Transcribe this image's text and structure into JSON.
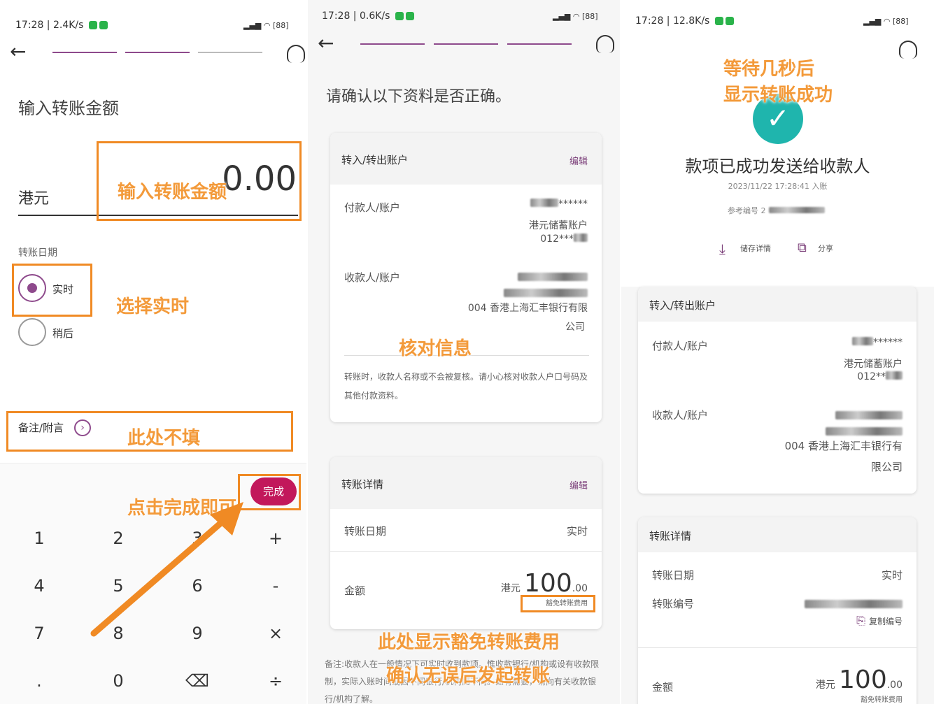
{
  "panel1": {
    "status_time": "17:28 | 2.4K/s",
    "battery": "88",
    "page_title": "输入转账金额",
    "currency": "港元",
    "amount": "0.00",
    "date_label": "转账日期",
    "radio_now": "实时",
    "radio_later": "稍后",
    "memo_label": "备注/附言",
    "done_button": "完成",
    "keypad": [
      "1",
      "2",
      "3",
      "+",
      "4",
      "5",
      "6",
      "-",
      "7",
      "8",
      "9",
      "×",
      ".",
      "0",
      "⌫",
      "÷"
    ],
    "annotations": {
      "enter_amount": "输入转账金额",
      "select_now": "选择实时",
      "no_fill": "此处不填",
      "click_done": "点击完成即可"
    }
  },
  "panel2": {
    "status_time": "17:28 | 0.6K/s",
    "battery": "88",
    "heading": "请确认以下资料是否正确。",
    "accounts_card": {
      "title": "转入/转出账户",
      "edit": "编辑",
      "payer_label": "付款人/账户",
      "payer_mask": "******",
      "payer_account_type": "港元储蓄账户",
      "payer_account_no": "012***",
      "payee_label": "收款人/账户",
      "payee_bank_line1": "004 香港上海汇丰银行有限",
      "payee_bank_line2": "公司",
      "note": "转账时，收款人名称或不会被复核。请小心核对收款人户口号码及其他付款资料。"
    },
    "details_card": {
      "title": "转账详情",
      "edit": "编辑",
      "date_label": "转账日期",
      "date_value": "实时",
      "amount_label": "金额",
      "currency": "港元",
      "amount_int": "100",
      "amount_dec": ".00",
      "fee_badge": "豁免转账费用"
    },
    "footer_note": "备注:收款人在一般情况下可实时收到款项。惟收款银行/机构或设有收款限制，实际入账时间或因不同银行/机构而不同。如有需要，请向有关收款银行/机构了解。",
    "annotations": {
      "verify": "核对信息",
      "fee_waived": "此处显示豁免转账费用",
      "confirm": "确认无误后发起转账"
    }
  },
  "panel3": {
    "status_time": "17:28 | 12.8K/s",
    "battery": "88",
    "success_title": "款项已成功发送给收款人",
    "timestamp": "2023/11/22 17:28:41 入账",
    "ref_label": "参考编号 2",
    "save_details": "储存详情",
    "share": "分享",
    "accounts_card": {
      "title": "转入/转出账户",
      "payer_label": "付款人/账户",
      "payer_mask": "******",
      "payer_account_type": "港元储蓄账户",
      "payer_account_no": "012**",
      "payee_label": "收款人/账户",
      "payee_bank_line1": "004 香港上海汇丰银行有",
      "payee_bank_line2": "限公司"
    },
    "details_card": {
      "title": "转账详情",
      "date_label": "转账日期",
      "date_value": "实时",
      "ref_label": "转账编号",
      "copy_ref": "复制编号",
      "amount_label": "金额",
      "currency": "港元",
      "amount_int": "100",
      "amount_dec": ".00",
      "fee_badge": "豁免转账费用"
    },
    "annotations": {
      "line1": "等待几秒后",
      "line2": "显示转账成功"
    }
  },
  "colors": {
    "accent": "#8e4a8c",
    "done_button": "#c2185b",
    "annotation": "#f08a24",
    "success": "#1fb5ad"
  }
}
